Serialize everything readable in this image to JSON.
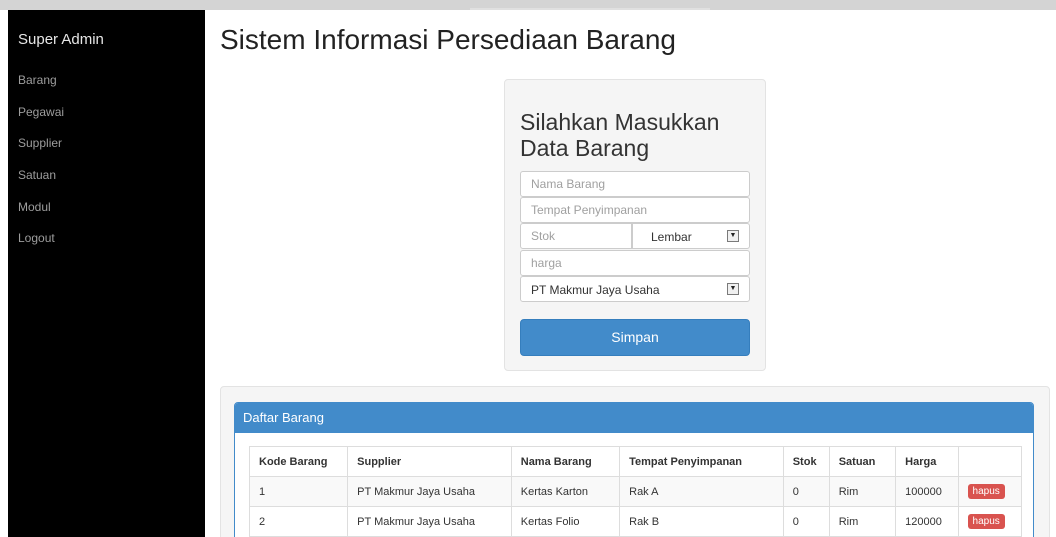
{
  "sidebar": {
    "brand": "Super Admin",
    "items": [
      {
        "label": "Barang"
      },
      {
        "label": "Pegawai"
      },
      {
        "label": "Supplier"
      },
      {
        "label": "Satuan"
      },
      {
        "label": "Modul"
      },
      {
        "label": "Logout"
      }
    ]
  },
  "page_title": "Sistem Informasi Persediaan Barang",
  "form": {
    "heading": "Silahkan Masukkan Data Barang",
    "nama_placeholder": "Nama Barang",
    "tempat_placeholder": "Tempat Penyimpanan",
    "stok_placeholder": "Stok",
    "satuan_selected": "Lembar",
    "harga_placeholder": "harga",
    "supplier_selected": "PT Makmur Jaya Usaha",
    "submit_label": "Simpan"
  },
  "table": {
    "title": "Daftar Barang",
    "headers": [
      "Kode Barang",
      "Supplier",
      "Nama Barang",
      "Tempat Penyimpanan",
      "Stok",
      "Satuan",
      "Harga"
    ],
    "rows": [
      [
        "1",
        "PT Makmur Jaya Usaha",
        "Kertas Karton",
        "Rak A",
        "0",
        "Rim",
        "100000"
      ],
      [
        "2",
        "PT Makmur Jaya Usaha",
        "Kertas Folio",
        "Rak B",
        "0",
        "Rim",
        "120000"
      ]
    ],
    "action_label": "hapus"
  },
  "colors": {
    "sidebar_bg": "#000000",
    "primary": "#428bca",
    "danger": "#d9534f"
  }
}
